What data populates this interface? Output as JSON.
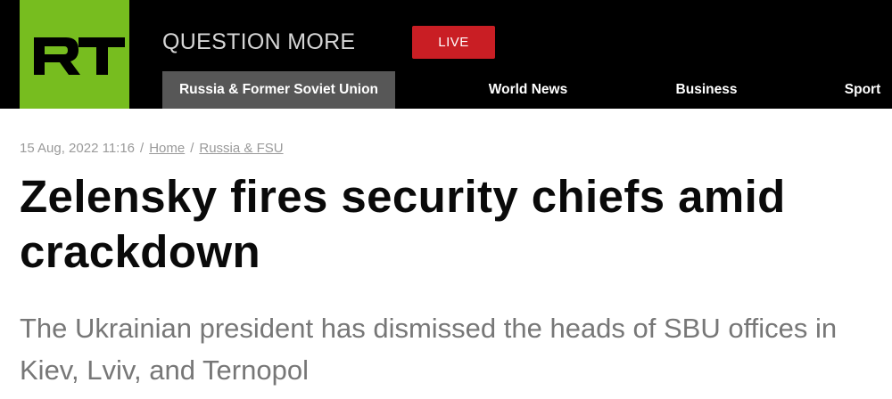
{
  "header": {
    "logo_text": "RT",
    "tagline": "QUESTION MORE",
    "live_label": "LIVE",
    "nav": [
      {
        "label": "Russia & Former Soviet Union",
        "active": true
      },
      {
        "label": "World News",
        "active": false
      },
      {
        "label": "Business",
        "active": false
      },
      {
        "label": "Sport",
        "active": false
      }
    ],
    "colors": {
      "brand_green": "#77bd1f",
      "live_red": "#c91e24",
      "active_nav": "#575757"
    }
  },
  "article": {
    "date": "15 Aug, 2022 11:16",
    "breadcrumb": [
      {
        "label": "Home"
      },
      {
        "label": "Russia & FSU"
      }
    ],
    "separator": "/",
    "headline": "Zelensky fires security chiefs amid crackdown",
    "summary": "The Ukrainian president has dismissed the heads of SBU offices in Kiev, Lviv, and Ternopol"
  }
}
